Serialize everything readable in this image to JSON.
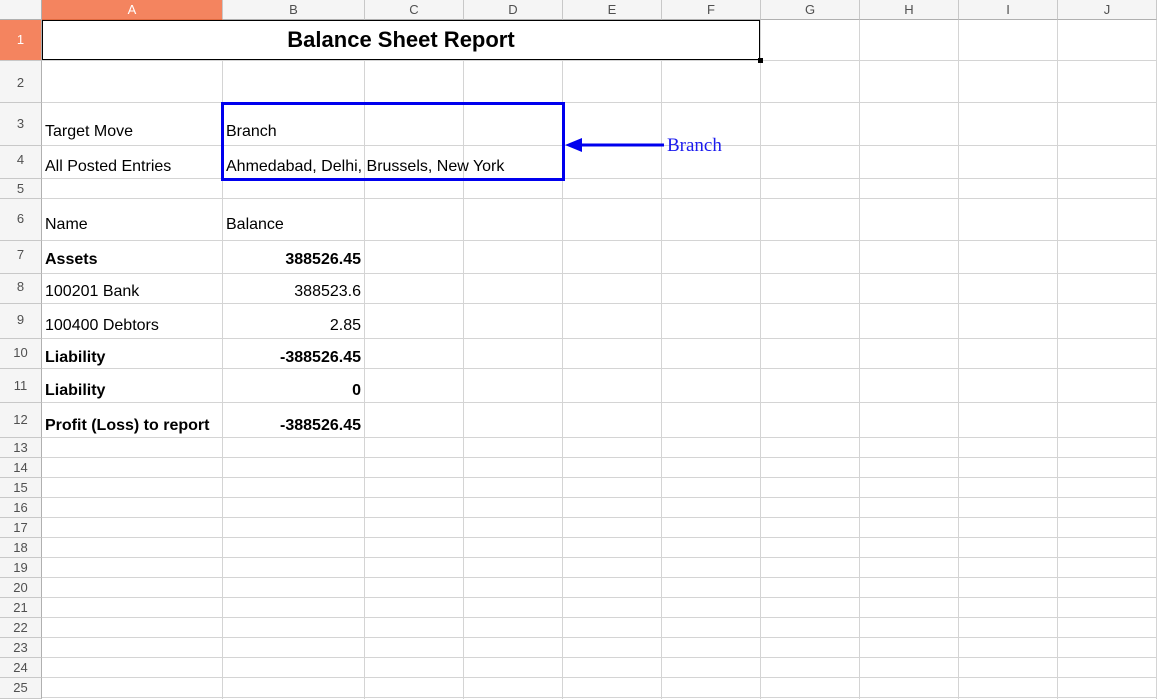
{
  "columns": [
    "A",
    "B",
    "C",
    "D",
    "E",
    "F",
    "G",
    "H",
    "I",
    "J"
  ],
  "rows": [
    "1",
    "2",
    "3",
    "4",
    "5",
    "6",
    "7",
    "8",
    "9",
    "10",
    "11",
    "12",
    "13",
    "14",
    "15",
    "16",
    "17",
    "18",
    "19",
    "20",
    "21",
    "22",
    "23",
    "24",
    "25"
  ],
  "title": "Balance Sheet Report",
  "cells": {
    "a3": "Target Move",
    "b3": "Branch",
    "a4": "All Posted Entries",
    "b4": "Ahmedabad, Delhi, Brussels, New York",
    "a6": "Name",
    "b6": "Balance",
    "a7": "Assets",
    "b7": "388526.45",
    "a8": "100201 Bank",
    "b8": "388523.6",
    "a9": "100400 Debtors",
    "b9": "2.85",
    "a10": "Liability",
    "b10": "-388526.45",
    "a11": "Liability",
    "b11": "0",
    "a12": "Profit (Loss) to report",
    "b12": "-388526.45"
  },
  "annotation": {
    "label": "Branch",
    "color": "#0000ee"
  },
  "selection": {
    "column": "A",
    "row": "1",
    "highlight_color": "#f4845f"
  }
}
